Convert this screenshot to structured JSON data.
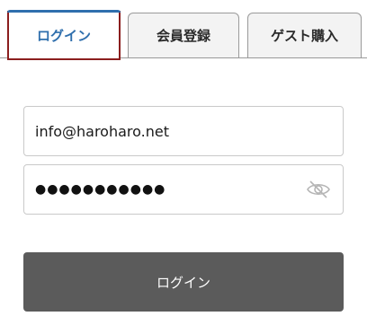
{
  "tabs": [
    {
      "label": "ログイン",
      "active": true
    },
    {
      "label": "会員登録",
      "active": false
    },
    {
      "label": "ゲスト購入",
      "active": false
    }
  ],
  "form": {
    "email_value": "info@haroharo.net",
    "password_masked": "●●●●●●●●●●●",
    "password_toggle_icon": "eye-slash-icon"
  },
  "submit": {
    "label": "ログイン"
  },
  "colors": {
    "active_tab_text": "#2f6fad",
    "active_tab_border": "#8b1e1e",
    "button_bg": "#5b5b5b"
  }
}
